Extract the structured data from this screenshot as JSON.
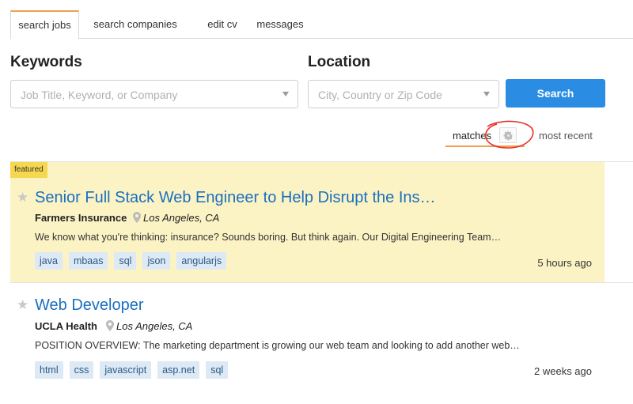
{
  "tabs": [
    "search jobs",
    "search companies",
    "edit cv",
    "messages"
  ],
  "search": {
    "keywords_label": "Keywords",
    "keywords_placeholder": "Job Title, Keyword, or Company",
    "location_label": "Location",
    "location_placeholder": "City, Country or Zip Code",
    "button": "Search"
  },
  "sort": {
    "matches": "matches",
    "recent": "most recent"
  },
  "jobs": [
    {
      "badge": "featured",
      "title": "Senior Full Stack Web Engineer to Help Disrupt the Ins…",
      "company": "Farmers Insurance",
      "location": "Los Angeles, CA",
      "description": "We know what you're thinking: insurance? Sounds boring. But think again. Our Digital Engineering Team…",
      "tags": [
        "java",
        "mbaas",
        "sql",
        "json",
        "angularjs"
      ],
      "time": "5 hours ago"
    },
    {
      "title": "Web Developer",
      "company": "UCLA Health",
      "location": "Los Angeles, CA",
      "description": "POSITION OVERVIEW: The marketing department is growing our web team and looking to add another web…",
      "tags": [
        "html",
        "css",
        "javascript",
        "asp.net",
        "sql"
      ],
      "time": "2 weeks ago"
    }
  ],
  "colors": {
    "accent": "#f0a050",
    "primary": "#2a8de3",
    "link": "#1a6fbf",
    "featured_bg": "#fcf3c5",
    "annotation": "#e8302a"
  }
}
